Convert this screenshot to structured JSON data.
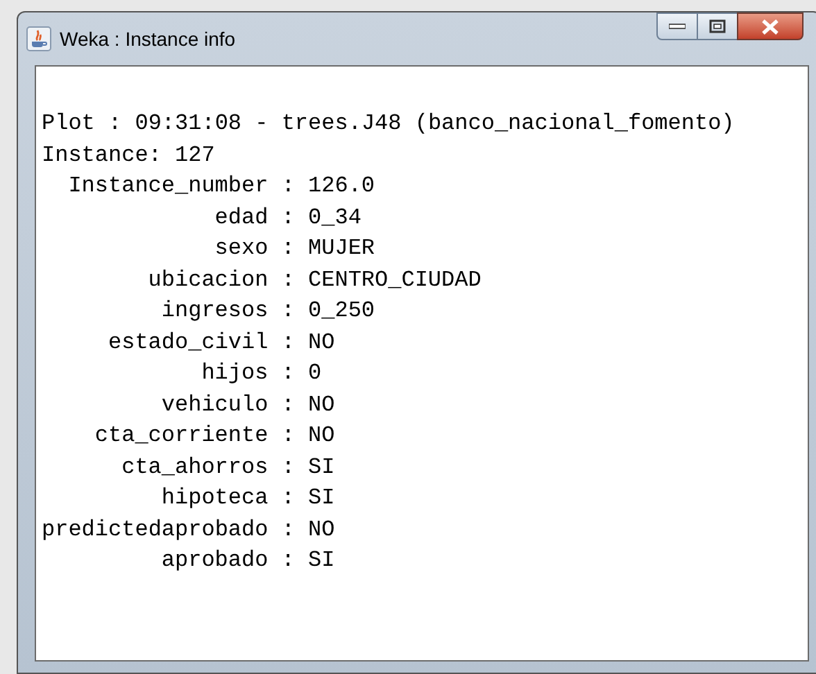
{
  "window": {
    "title": "Weka : Instance info"
  },
  "header_lines": [
    "Plot : 09:31:08 - trees.J48 (banco_nacional_fomento)",
    "Instance: 127"
  ],
  "attribute_lines": [
    "Instance_number : 126.0",
    "edad : 0_34",
    "sexo : MUJER",
    "ubicacion : CENTRO_CIUDAD",
    "ingresos : 0_250",
    "estado_civil : NO",
    "hijos : 0",
    "vehiculo : NO",
    "cta_corriente : NO",
    "cta_ahorros : SI",
    "hipoteca : SI",
    "predictedaprobado : NO",
    "aprobado : SI"
  ]
}
